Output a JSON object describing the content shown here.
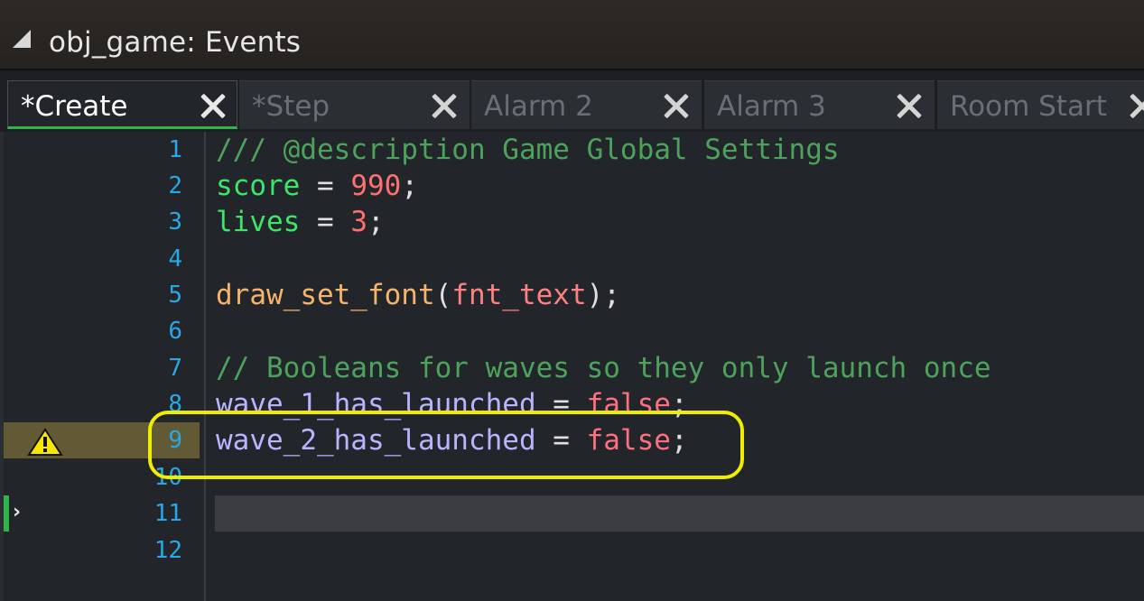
{
  "window": {
    "title": "obj_game: Events"
  },
  "tabs": [
    {
      "label": "*Create",
      "active": true
    },
    {
      "label": "*Step",
      "active": false
    },
    {
      "label": "Alarm 2",
      "active": false
    },
    {
      "label": "Alarm 3",
      "active": false
    },
    {
      "label": "Room Start",
      "active": false
    }
  ],
  "editor": {
    "line_numbers": [
      "1",
      "2",
      "3",
      "4",
      "5",
      "6",
      "7",
      "8",
      "9",
      "10",
      "11",
      "12"
    ],
    "lines": {
      "l1": {
        "comment": "/// @description Game Global Settings"
      },
      "l2": {
        "var": "score",
        "op": " = ",
        "num": "990",
        "end": ";"
      },
      "l3": {
        "var": "lives",
        "op": " = ",
        "num": "3",
        "end": ";"
      },
      "l5": {
        "func": "draw_set_font",
        "open": "(",
        "arg": "fnt_text",
        "close": ");"
      },
      "l7": {
        "comment": "// Booleans for waves so they only launch once"
      },
      "l8": {
        "var": "wave_1_has_launched",
        "op": " = ",
        "val": "false",
        "end": ";"
      },
      "l9": {
        "var": "wave_2_has_launched",
        "op": " = ",
        "val": "false",
        "end": ";"
      }
    },
    "warning_line": "9",
    "current_line": "11"
  },
  "colors": {
    "comment": "#4da35b",
    "variable": "#3de56a",
    "number": "#ff7070",
    "function": "#f5b46a",
    "instance_var": "#b8b4ff",
    "keyword": "#ff6f7f",
    "line_number": "#2aa7e4",
    "highlight_ring": "#f0ee00",
    "active_tab_underline": "#2fb34a"
  },
  "icons": {
    "collapse": "collapse-triangle-icon",
    "close": "close-x-icon",
    "warning": "warning-icon",
    "current_line": "chevron-right-icon"
  }
}
